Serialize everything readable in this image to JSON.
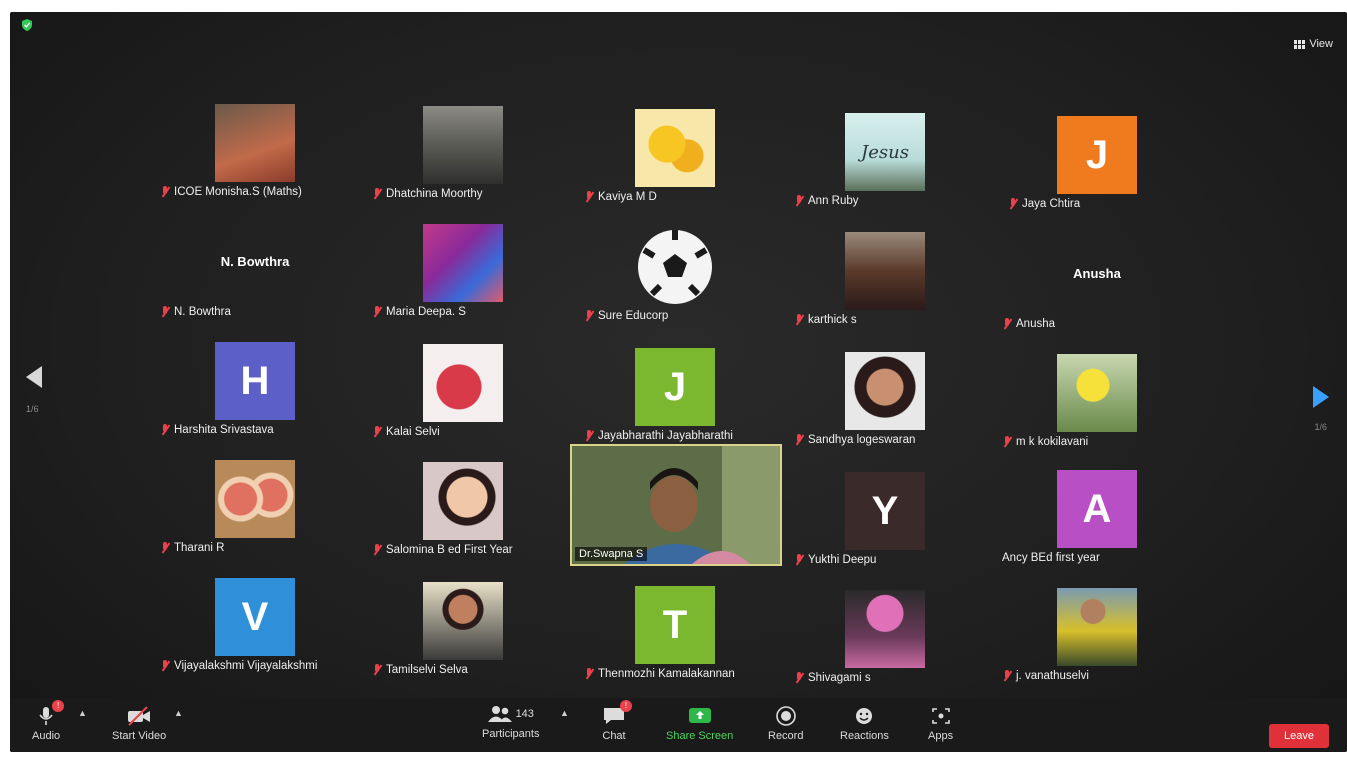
{
  "top": {
    "view_label": "View"
  },
  "navigation": {
    "page_left": "1/6",
    "page_right": "1/6"
  },
  "participants": [
    {
      "name": "ICOE Monisha.S (Maths)",
      "avatar": "photo",
      "muted": true
    },
    {
      "name": "Dhatchina Moorthy",
      "avatar": "photo",
      "muted": true
    },
    {
      "name": "Kaviya M D",
      "avatar": "emoji-photo",
      "muted": true
    },
    {
      "name": "Ann Ruby",
      "avatar": "photo",
      "photo_text": "Jesus",
      "muted": true
    },
    {
      "name": "Jaya Chtira",
      "avatar": "letter",
      "letter": "J",
      "color": "#f07a1e",
      "muted": true
    },
    {
      "name": "N. Bowthra",
      "avatar": "name",
      "display_name": "N. Bowthra",
      "muted": true
    },
    {
      "name": "Maria Deepa. S",
      "avatar": "photo",
      "muted": true
    },
    {
      "name": "Sure Educorp",
      "avatar": "football-photo",
      "muted": true
    },
    {
      "name": "karthick s",
      "avatar": "photo",
      "muted": true
    },
    {
      "name": "Anusha",
      "avatar": "name",
      "display_name": "Anusha",
      "muted": true
    },
    {
      "name": "Harshita Srivastava",
      "avatar": "letter",
      "letter": "H",
      "color": "#5b5fc7",
      "muted": true
    },
    {
      "name": "Kalai Selvi",
      "avatar": "photo",
      "muted": true
    },
    {
      "name": "Jayabharathi Jayabharathi",
      "avatar": "letter",
      "letter": "J",
      "color": "#7cb82f",
      "muted": true
    },
    {
      "name": "Sandhya logeswaran",
      "avatar": "photo",
      "muted": true
    },
    {
      "name": "m k kokilavani",
      "avatar": "photo",
      "muted": true
    },
    {
      "name": "Tharani R",
      "avatar": "photo",
      "muted": true
    },
    {
      "name": "Salomina B ed First Year",
      "avatar": "photo",
      "muted": true
    },
    {
      "name": "Dr.Swapna S",
      "avatar": "video",
      "muted": false
    },
    {
      "name": "Yukthi Deepu",
      "avatar": "letter",
      "letter": "Y",
      "color": "#3a2a2a",
      "muted": true
    },
    {
      "name": "Ancy BEd first year",
      "avatar": "letter",
      "letter": "A",
      "color": "#b94fc4",
      "muted": false
    },
    {
      "name": "Vijayalakshmi Vijayalakshmi",
      "avatar": "letter",
      "letter": "V",
      "color": "#2f8fd8",
      "muted": true
    },
    {
      "name": "Tamilselvi Selva",
      "avatar": "photo",
      "muted": true
    },
    {
      "name": "Thenmozhi Kamalakannan",
      "avatar": "letter",
      "letter": "T",
      "color": "#7cb82f",
      "muted": true
    },
    {
      "name": "Shivagami s",
      "avatar": "photo",
      "muted": true
    },
    {
      "name": "j. vanathuselvi",
      "avatar": "photo",
      "muted": true
    }
  ],
  "toolbar": {
    "audio_label": "Audio",
    "video_label": "Start Video",
    "participants_label": "Participants",
    "participants_count": "143",
    "chat_label": "Chat",
    "share_label": "Share Screen",
    "record_label": "Record",
    "reactions_label": "Reactions",
    "apps_label": "Apps",
    "leave_label": "Leave"
  },
  "colors": {
    "share_accent": "#4ad45e",
    "leave": "#e0303a",
    "muted_mic": "#e9424a",
    "nav_arrow_right": "#3aa0ff"
  }
}
